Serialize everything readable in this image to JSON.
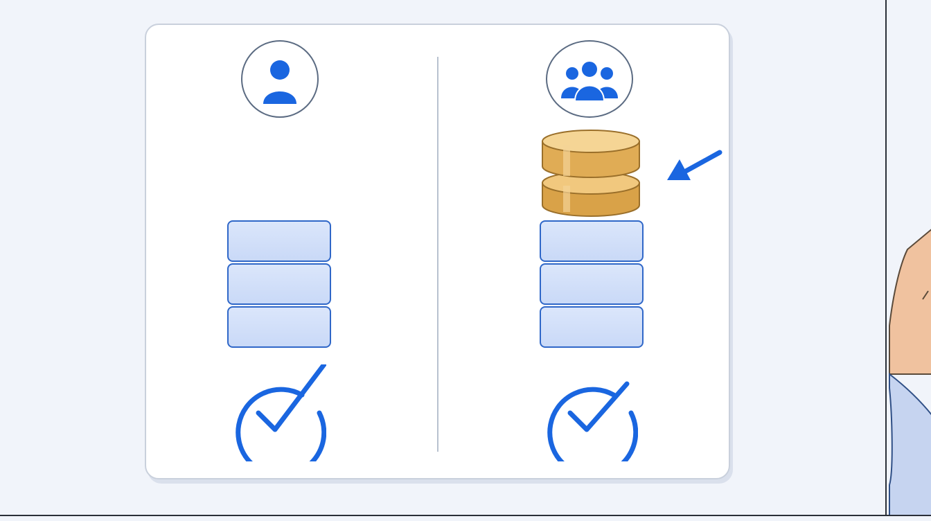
{
  "diagram": {
    "left_panel": {
      "icon": "single-user-icon",
      "block_count": 3,
      "status_icon": "check-circle-icon"
    },
    "right_panel": {
      "icon": "user-group-icon",
      "extra_item": "coin-stack-icon",
      "block_count": 3,
      "status_icon": "check-circle-icon",
      "pointer": "arrow-icon"
    }
  },
  "colors": {
    "accent_blue": "#1a66e0",
    "block_fill": "#d3e0f8",
    "block_border": "#2f67c8",
    "coin_gold": "#e8b45e",
    "card_border": "#c9d0dc",
    "background": "#f1f4fa"
  }
}
